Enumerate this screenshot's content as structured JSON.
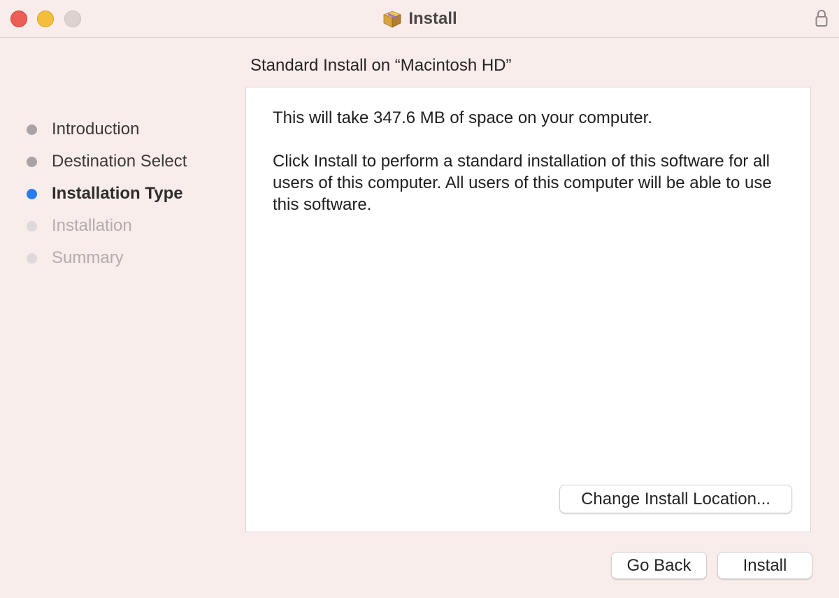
{
  "window": {
    "title": "Install",
    "title_icon": "package-icon",
    "lock_icon": "lock-icon"
  },
  "sidebar": {
    "steps": [
      {
        "label": "Introduction",
        "state": "done"
      },
      {
        "label": "Destination Select",
        "state": "done"
      },
      {
        "label": "Installation Type",
        "state": "current"
      },
      {
        "label": "Installation",
        "state": "pending"
      },
      {
        "label": "Summary",
        "state": "pending"
      }
    ]
  },
  "main": {
    "heading": "Standard Install on “Macintosh HD”",
    "paragraph1": "This will take 347.6 MB of space on your computer.",
    "paragraph2": "Click Install to perform a standard installation of this software for all users of this computer. All users of this computer will be able to use this software.",
    "change_location_label": "Change Install Location..."
  },
  "footer": {
    "go_back_label": "Go Back",
    "install_label": "Install"
  },
  "colors": {
    "background": "#f8edeb",
    "current_step": "#2a7bf5",
    "close": "#ed5e57",
    "minimize": "#f4bd3c",
    "zoom": "#dcd3d1"
  }
}
